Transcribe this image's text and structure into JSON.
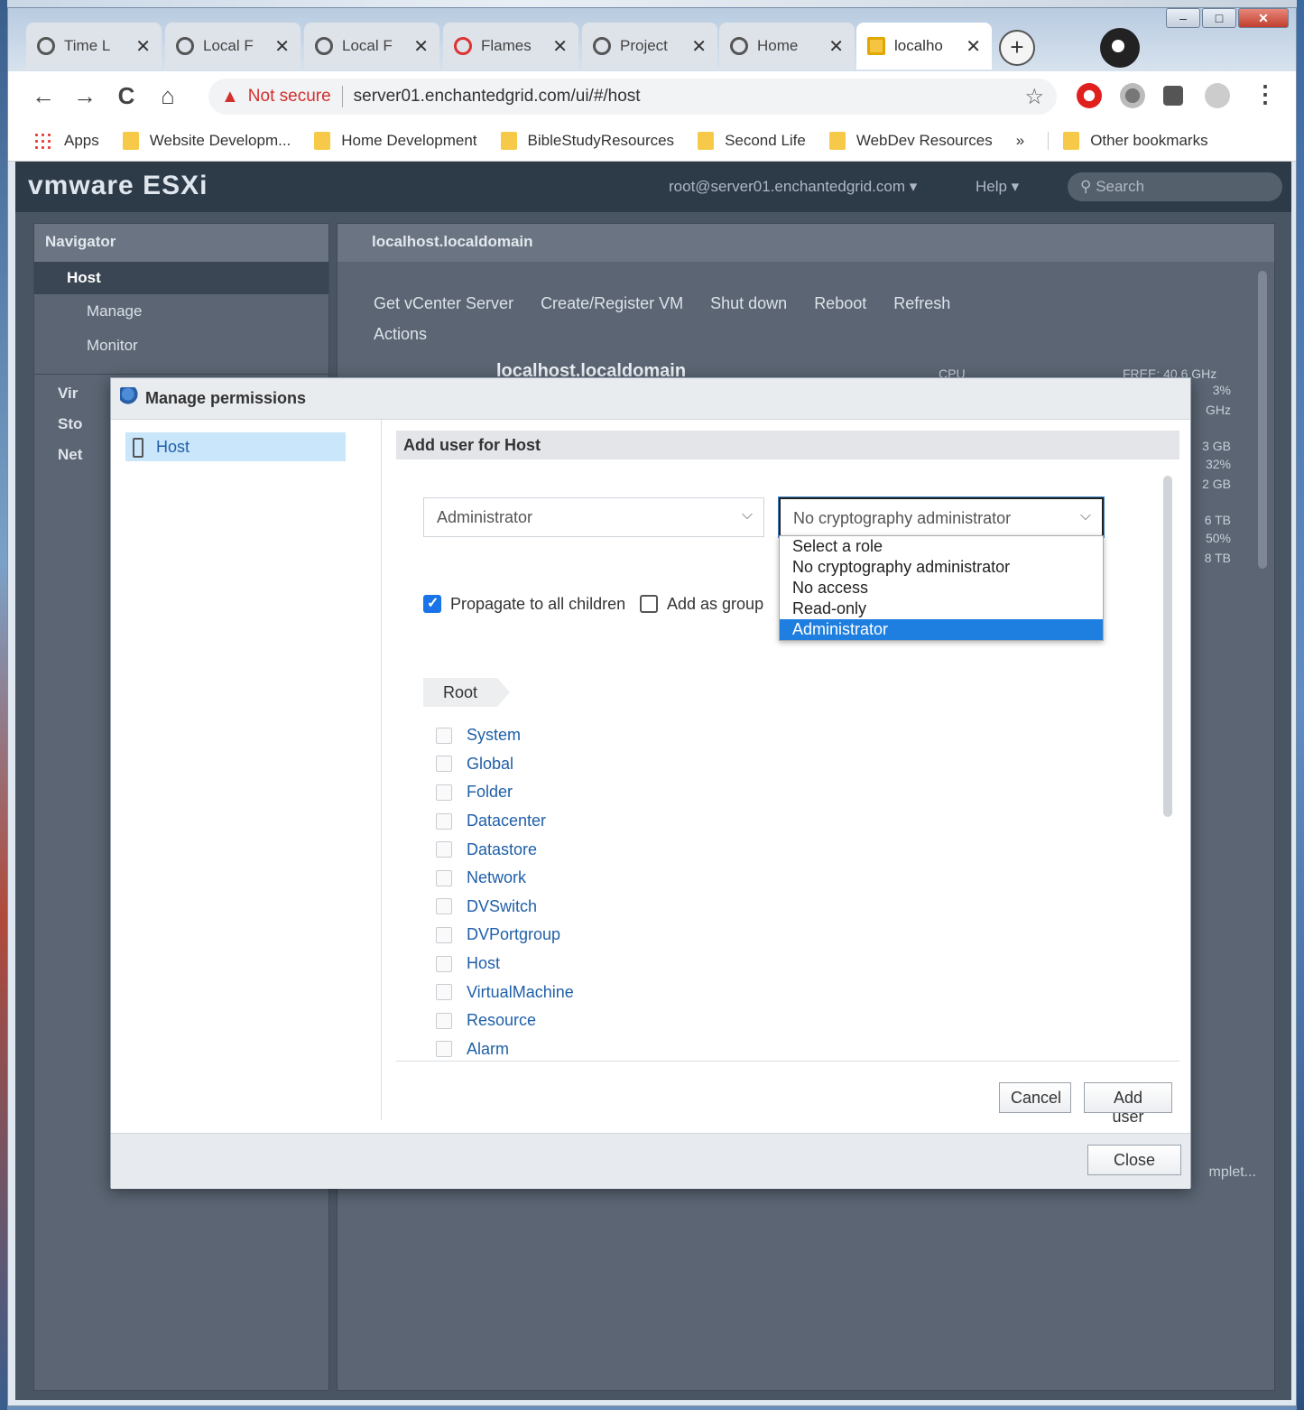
{
  "browser": {
    "tabs": [
      {
        "title": "Time L",
        "close": "✕"
      },
      {
        "title": "Local F",
        "close": "✕"
      },
      {
        "title": "Local F",
        "close": "✕"
      },
      {
        "title": "Flames",
        "close": "✕"
      },
      {
        "title": "Project",
        "close": "✕"
      },
      {
        "title": "Home",
        "close": "✕"
      },
      {
        "title": "localho",
        "close": "✕"
      }
    ],
    "new_tab": "+",
    "window_controls": {
      "minimize": "–",
      "maximize": "□",
      "close": "✕"
    },
    "security": "Not secure",
    "url": "server01.enchantedgrid.com/ui/#/host",
    "bookmarks": [
      "Apps",
      "Website Developm...",
      "Home Development",
      "BibleStudyResources",
      "Second Life",
      "WebDev Resources"
    ],
    "bookmarks_more": "»",
    "other_bookmarks": "Other bookmarks",
    "icons": {
      "back": "←",
      "forward": "→",
      "reload": "C",
      "home": "⌂",
      "star": "☆",
      "menu": "⋮"
    }
  },
  "esxi": {
    "logo": "vmware ESXi",
    "user": "root@server01.enchantedgrid.com ▾",
    "help": "Help ▾",
    "search_placeholder": "Search",
    "navigator": {
      "title": "Navigator",
      "host": "Host",
      "manage": "Manage",
      "monitor": "Monitor",
      "items": [
        "Vir",
        "Sto",
        "Net"
      ]
    },
    "main": {
      "title": "localhost.localdomain",
      "toolbar": [
        "Get vCenter Server",
        "Create/Register VM",
        "Shut down",
        "Reboot",
        "Refresh"
      ],
      "actions": "Actions",
      "host_name": "localhost.localdomain",
      "cpu_label": "CPU",
      "cpu_free": "FREE: 40.6 GHz",
      "stats": [
        "3%",
        "GHz",
        "3 GB",
        "32%",
        "2 GB",
        "6 TB",
        "50%",
        "8 TB"
      ],
      "lower_select": "mplet..."
    }
  },
  "modal": {
    "title": "Manage permissions",
    "tree_item": "Host",
    "section_title": "Add user for Host",
    "user_select": "Administrator",
    "role_select": "No cryptography administrator",
    "role_options": [
      "Select a role",
      "No cryptography administrator",
      "No access",
      "Read-only",
      "Administrator"
    ],
    "role_highlighted": "Administrator",
    "propagate_label": "Propagate to all children",
    "propagate_checked": true,
    "group_label": "Add as group",
    "group_checked": false,
    "breadcrumb": "Root",
    "privileges": [
      "System",
      "Global",
      "Folder",
      "Datacenter",
      "Datastore",
      "Network",
      "DVSwitch",
      "DVPortgroup",
      "Host",
      "VirtualMachine",
      "Resource",
      "Alarm"
    ],
    "cancel": "Cancel",
    "add_user": "Add user",
    "close": "Close"
  },
  "colors": {
    "accent": "#1e7fe0",
    "not_secure": "#d32f2f",
    "link": "#1f5fa8",
    "tree_selected": "#c9e6fb"
  }
}
